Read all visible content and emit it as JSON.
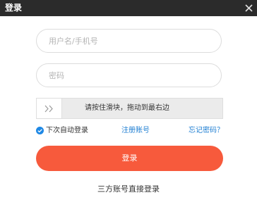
{
  "window": {
    "title": "登录",
    "close_icon": "close-icon"
  },
  "form": {
    "username_placeholder": "用户名/手机号",
    "username_value": "",
    "password_placeholder": "密码",
    "password_value": ""
  },
  "slider": {
    "handle_icon": "double-chevron-right-icon",
    "text": "请按住滑块，拖动到最右边",
    "progress": 0
  },
  "options": {
    "remember_label": "下次自动登录",
    "remember_checked": true,
    "register_label": "注册账号",
    "forgot_label": "忘记密码？"
  },
  "login_button_label": "登录",
  "third_party_label": "三方账号直接登录",
  "colors": {
    "titlebar": "#2b2b2b",
    "primary_button": "#f75a3c",
    "link": "#1e7ed2",
    "check": "#1e88e5"
  }
}
